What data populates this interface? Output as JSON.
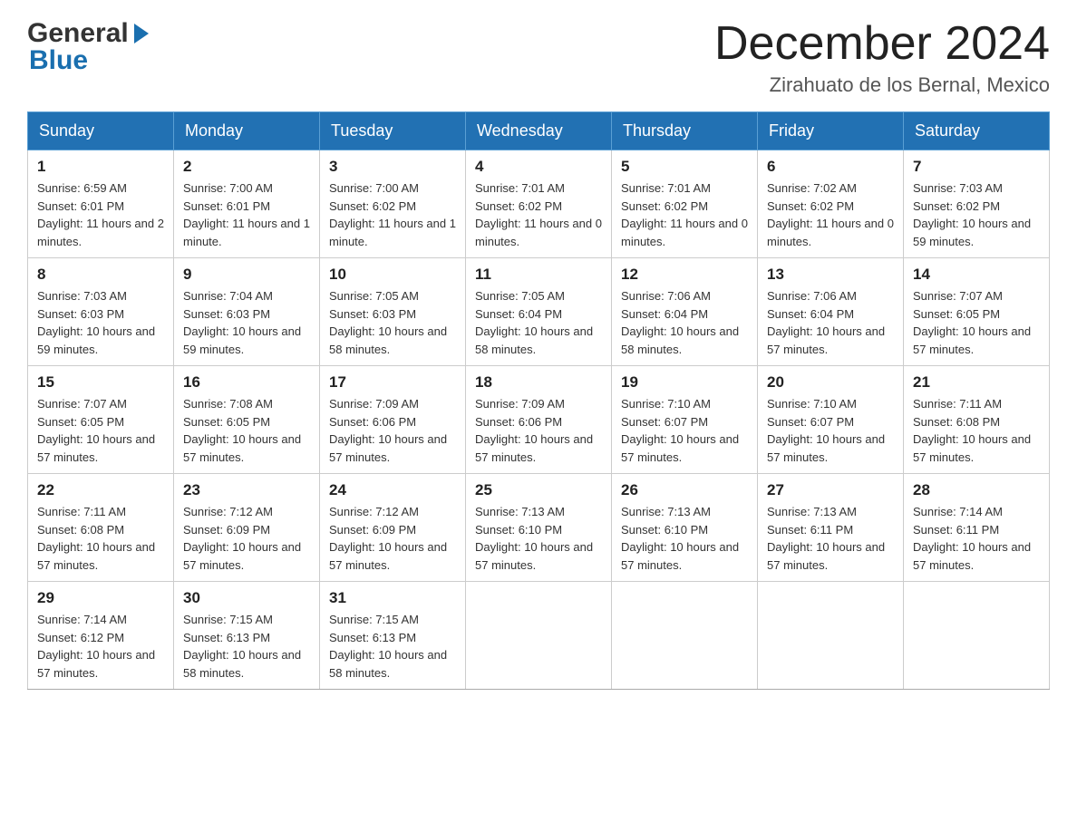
{
  "header": {
    "logo_general": "General",
    "logo_blue": "Blue",
    "title": "December 2024",
    "location": "Zirahuato de los Bernal, Mexico"
  },
  "days_of_week": [
    "Sunday",
    "Monday",
    "Tuesday",
    "Wednesday",
    "Thursday",
    "Friday",
    "Saturday"
  ],
  "weeks": [
    [
      {
        "day": "1",
        "sunrise": "Sunrise: 6:59 AM",
        "sunset": "Sunset: 6:01 PM",
        "daylight": "Daylight: 11 hours and 2 minutes."
      },
      {
        "day": "2",
        "sunrise": "Sunrise: 7:00 AM",
        "sunset": "Sunset: 6:01 PM",
        "daylight": "Daylight: 11 hours and 1 minute."
      },
      {
        "day": "3",
        "sunrise": "Sunrise: 7:00 AM",
        "sunset": "Sunset: 6:02 PM",
        "daylight": "Daylight: 11 hours and 1 minute."
      },
      {
        "day": "4",
        "sunrise": "Sunrise: 7:01 AM",
        "sunset": "Sunset: 6:02 PM",
        "daylight": "Daylight: 11 hours and 0 minutes."
      },
      {
        "day": "5",
        "sunrise": "Sunrise: 7:01 AM",
        "sunset": "Sunset: 6:02 PM",
        "daylight": "Daylight: 11 hours and 0 minutes."
      },
      {
        "day": "6",
        "sunrise": "Sunrise: 7:02 AM",
        "sunset": "Sunset: 6:02 PM",
        "daylight": "Daylight: 11 hours and 0 minutes."
      },
      {
        "day": "7",
        "sunrise": "Sunrise: 7:03 AM",
        "sunset": "Sunset: 6:02 PM",
        "daylight": "Daylight: 10 hours and 59 minutes."
      }
    ],
    [
      {
        "day": "8",
        "sunrise": "Sunrise: 7:03 AM",
        "sunset": "Sunset: 6:03 PM",
        "daylight": "Daylight: 10 hours and 59 minutes."
      },
      {
        "day": "9",
        "sunrise": "Sunrise: 7:04 AM",
        "sunset": "Sunset: 6:03 PM",
        "daylight": "Daylight: 10 hours and 59 minutes."
      },
      {
        "day": "10",
        "sunrise": "Sunrise: 7:05 AM",
        "sunset": "Sunset: 6:03 PM",
        "daylight": "Daylight: 10 hours and 58 minutes."
      },
      {
        "day": "11",
        "sunrise": "Sunrise: 7:05 AM",
        "sunset": "Sunset: 6:04 PM",
        "daylight": "Daylight: 10 hours and 58 minutes."
      },
      {
        "day": "12",
        "sunrise": "Sunrise: 7:06 AM",
        "sunset": "Sunset: 6:04 PM",
        "daylight": "Daylight: 10 hours and 58 minutes."
      },
      {
        "day": "13",
        "sunrise": "Sunrise: 7:06 AM",
        "sunset": "Sunset: 6:04 PM",
        "daylight": "Daylight: 10 hours and 57 minutes."
      },
      {
        "day": "14",
        "sunrise": "Sunrise: 7:07 AM",
        "sunset": "Sunset: 6:05 PM",
        "daylight": "Daylight: 10 hours and 57 minutes."
      }
    ],
    [
      {
        "day": "15",
        "sunrise": "Sunrise: 7:07 AM",
        "sunset": "Sunset: 6:05 PM",
        "daylight": "Daylight: 10 hours and 57 minutes."
      },
      {
        "day": "16",
        "sunrise": "Sunrise: 7:08 AM",
        "sunset": "Sunset: 6:05 PM",
        "daylight": "Daylight: 10 hours and 57 minutes."
      },
      {
        "day": "17",
        "sunrise": "Sunrise: 7:09 AM",
        "sunset": "Sunset: 6:06 PM",
        "daylight": "Daylight: 10 hours and 57 minutes."
      },
      {
        "day": "18",
        "sunrise": "Sunrise: 7:09 AM",
        "sunset": "Sunset: 6:06 PM",
        "daylight": "Daylight: 10 hours and 57 minutes."
      },
      {
        "day": "19",
        "sunrise": "Sunrise: 7:10 AM",
        "sunset": "Sunset: 6:07 PM",
        "daylight": "Daylight: 10 hours and 57 minutes."
      },
      {
        "day": "20",
        "sunrise": "Sunrise: 7:10 AM",
        "sunset": "Sunset: 6:07 PM",
        "daylight": "Daylight: 10 hours and 57 minutes."
      },
      {
        "day": "21",
        "sunrise": "Sunrise: 7:11 AM",
        "sunset": "Sunset: 6:08 PM",
        "daylight": "Daylight: 10 hours and 57 minutes."
      }
    ],
    [
      {
        "day": "22",
        "sunrise": "Sunrise: 7:11 AM",
        "sunset": "Sunset: 6:08 PM",
        "daylight": "Daylight: 10 hours and 57 minutes."
      },
      {
        "day": "23",
        "sunrise": "Sunrise: 7:12 AM",
        "sunset": "Sunset: 6:09 PM",
        "daylight": "Daylight: 10 hours and 57 minutes."
      },
      {
        "day": "24",
        "sunrise": "Sunrise: 7:12 AM",
        "sunset": "Sunset: 6:09 PM",
        "daylight": "Daylight: 10 hours and 57 minutes."
      },
      {
        "day": "25",
        "sunrise": "Sunrise: 7:13 AM",
        "sunset": "Sunset: 6:10 PM",
        "daylight": "Daylight: 10 hours and 57 minutes."
      },
      {
        "day": "26",
        "sunrise": "Sunrise: 7:13 AM",
        "sunset": "Sunset: 6:10 PM",
        "daylight": "Daylight: 10 hours and 57 minutes."
      },
      {
        "day": "27",
        "sunrise": "Sunrise: 7:13 AM",
        "sunset": "Sunset: 6:11 PM",
        "daylight": "Daylight: 10 hours and 57 minutes."
      },
      {
        "day": "28",
        "sunrise": "Sunrise: 7:14 AM",
        "sunset": "Sunset: 6:11 PM",
        "daylight": "Daylight: 10 hours and 57 minutes."
      }
    ],
    [
      {
        "day": "29",
        "sunrise": "Sunrise: 7:14 AM",
        "sunset": "Sunset: 6:12 PM",
        "daylight": "Daylight: 10 hours and 57 minutes."
      },
      {
        "day": "30",
        "sunrise": "Sunrise: 7:15 AM",
        "sunset": "Sunset: 6:13 PM",
        "daylight": "Daylight: 10 hours and 58 minutes."
      },
      {
        "day": "31",
        "sunrise": "Sunrise: 7:15 AM",
        "sunset": "Sunset: 6:13 PM",
        "daylight": "Daylight: 10 hours and 58 minutes."
      },
      null,
      null,
      null,
      null
    ]
  ]
}
